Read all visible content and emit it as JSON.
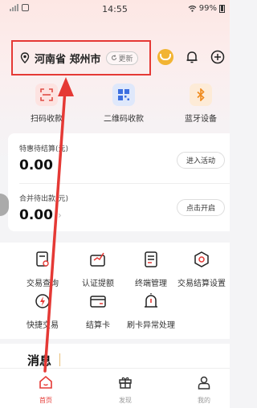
{
  "status_bar": {
    "time": "14:55",
    "battery": "99%"
  },
  "header": {
    "location": "河南省 郑州市",
    "refresh_label": "更新"
  },
  "quick_actions": [
    {
      "label": "扫码收款",
      "icon": "scan-icon"
    },
    {
      "label": "二维码收款",
      "icon": "qrcode-icon"
    },
    {
      "label": "蓝牙设备",
      "icon": "bluetooth-icon"
    }
  ],
  "settlement": {
    "discount_title": "特惠待结算(元)",
    "discount_amount": "0.00",
    "discount_button": "进入活动",
    "merge_title": "合并待出款(元)",
    "merge_amount": "0.00",
    "merge_button": "点击开启"
  },
  "tools": [
    {
      "label": "交易查询",
      "icon": "transaction-query-icon"
    },
    {
      "label": "认证提额",
      "icon": "certification-icon"
    },
    {
      "label": "终端管理",
      "icon": "terminal-icon"
    },
    {
      "label": "交易结算设置",
      "icon": "settlement-settings-icon"
    },
    {
      "label": "快捷交易",
      "icon": "quick-trade-icon"
    },
    {
      "label": "结算卡",
      "icon": "card-icon"
    },
    {
      "label": "刷卡异常处理",
      "icon": "alert-icon"
    }
  ],
  "messages": {
    "title": "消息"
  },
  "bottom_nav": [
    {
      "label": "首页",
      "icon": "home-icon",
      "active": true
    },
    {
      "label": "发现",
      "icon": "gift-icon",
      "active": false
    },
    {
      "label": "我的",
      "icon": "user-icon",
      "active": false
    }
  ],
  "colors": {
    "accent": "#e53935",
    "annotation": "#e53935",
    "coin": "#f2b433"
  }
}
